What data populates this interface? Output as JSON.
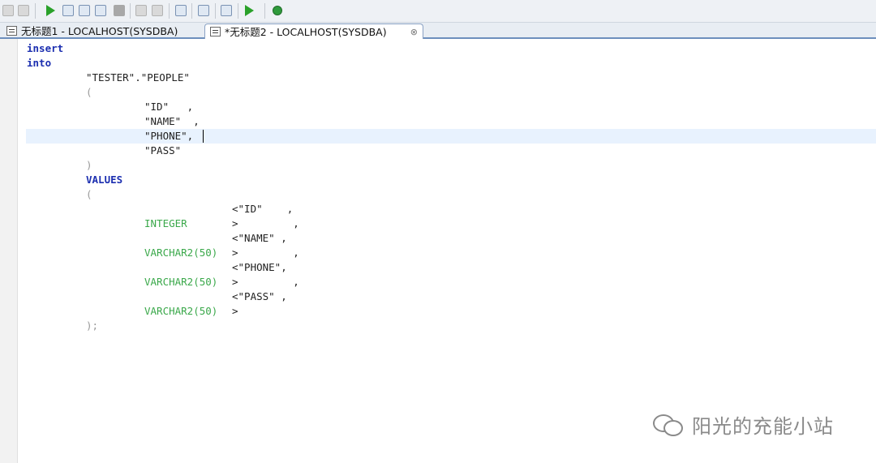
{
  "tabs": [
    {
      "label": "无标题1 - LOCALHOST(SYSDBA)"
    },
    {
      "label": "*无标题2 - LOCALHOST(SYSDBA)",
      "close_glyph": "⊗"
    }
  ],
  "code": {
    "l1": "insert",
    "l2": "into",
    "l3": "\"TESTER\".\"PEOPLE\"",
    "l4": "(",
    "l5": "\"ID\"   ,",
    "l6": "\"NAME\"  ,",
    "l7": "\"PHONE\",",
    "l8": "\"PASS\"",
    "l9": ")",
    "l10": "VALUES",
    "l11": "(",
    "l12": "<\"ID\"    ,",
    "l13a": "INTEGER",
    "l13b": ">         ,",
    "l14": "<\"NAME\" ,",
    "l15a": "VARCHAR2(50)",
    "l15b": ">         ,",
    "l16": "<\"PHONE\",",
    "l17a": "VARCHAR2(50)",
    "l17b": ">         ,",
    "l18": "<\"PASS\" ,",
    "l19a": "VARCHAR2(50)",
    "l19b": ">",
    "l20": ");"
  },
  "watermark": {
    "text": "阳光的充能小站"
  },
  "colors": {
    "keyword": "#1c2fb0",
    "type": "#3aa84a",
    "current_line": "#e8f2fe"
  }
}
